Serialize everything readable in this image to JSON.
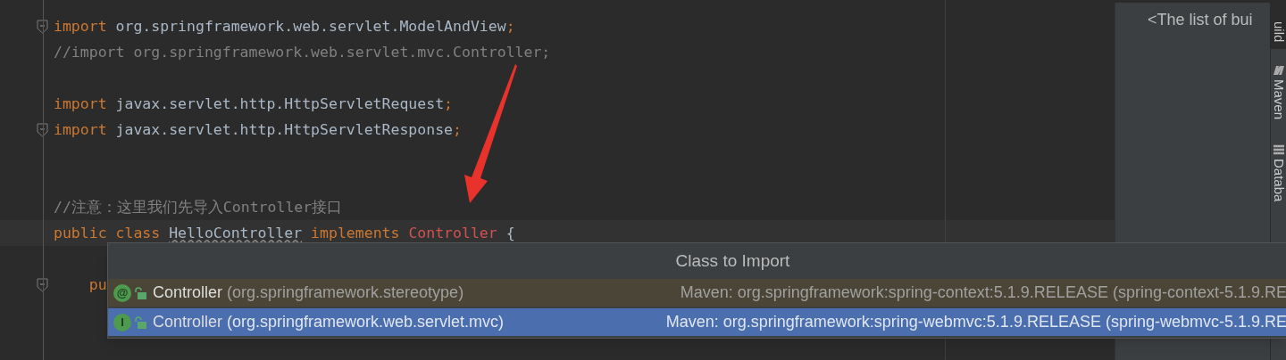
{
  "editor": {
    "lines": [
      {
        "kind": "code",
        "fold": true,
        "current": false,
        "tokens": [
          {
            "kind": "keyword",
            "text": "import"
          },
          {
            "kind": "plain",
            "text": " org.springframework.web.servlet.ModelAndView"
          },
          {
            "kind": "keyword",
            "text": ";"
          }
        ]
      },
      {
        "kind": "code",
        "fold": false,
        "current": false,
        "tokens": [
          {
            "kind": "comment",
            "text": "//import org.springframework.web.servlet.mvc.Controller;"
          }
        ]
      },
      {
        "kind": "blank"
      },
      {
        "kind": "code",
        "fold": false,
        "current": false,
        "tokens": [
          {
            "kind": "keyword",
            "text": "import"
          },
          {
            "kind": "plain",
            "text": " javax.servlet.http.HttpServletRequest"
          },
          {
            "kind": "keyword",
            "text": ";"
          }
        ]
      },
      {
        "kind": "code",
        "fold": true,
        "current": false,
        "tokens": [
          {
            "kind": "keyword",
            "text": "import"
          },
          {
            "kind": "plain",
            "text": " javax.servlet.http.HttpServletResponse"
          },
          {
            "kind": "keyword",
            "text": ";"
          }
        ]
      },
      {
        "kind": "blank"
      },
      {
        "kind": "blank"
      },
      {
        "kind": "code",
        "fold": false,
        "current": false,
        "tokens": [
          {
            "kind": "comment",
            "text": "//注意：这里我们先导入Controller接口"
          }
        ]
      },
      {
        "kind": "code",
        "fold": false,
        "current": true,
        "tokens": [
          {
            "kind": "keyword",
            "text": "public class "
          },
          {
            "kind": "warning",
            "text": "HelloController"
          },
          {
            "kind": "keyword",
            "text": " implements "
          },
          {
            "kind": "error",
            "text": "Controller"
          },
          {
            "kind": "plain",
            "text": " {"
          }
        ]
      },
      {
        "kind": "blank"
      },
      {
        "kind": "code",
        "fold": true,
        "current": false,
        "tokens": [
          {
            "kind": "keyword",
            "text": "    pu"
          }
        ]
      }
    ]
  },
  "import_popup": {
    "title": "Class to Import",
    "items": [
      {
        "badge": "@",
        "name": "Controller",
        "package": "(org.springframework.stereotype)",
        "source": "Maven: org.springframework:spring-context:5.1.9.RELEASE (spring-context-5.1.9.RE",
        "selected": false
      },
      {
        "badge": "I",
        "name": "Controller",
        "package": "(org.springframework.web.servlet.mvc)",
        "source": "Maven: org.springframework:spring-webmvc:5.1.9.RELEASE (spring-webmvc-5.1.9.RE",
        "selected": true
      }
    ]
  },
  "build_panel": {
    "text": "<The list of bui"
  },
  "tool_tabs": [
    {
      "label": "uild",
      "selected": true
    },
    {
      "label": "Maven",
      "selected": false
    },
    {
      "label": "Databa",
      "selected": false
    }
  ]
}
